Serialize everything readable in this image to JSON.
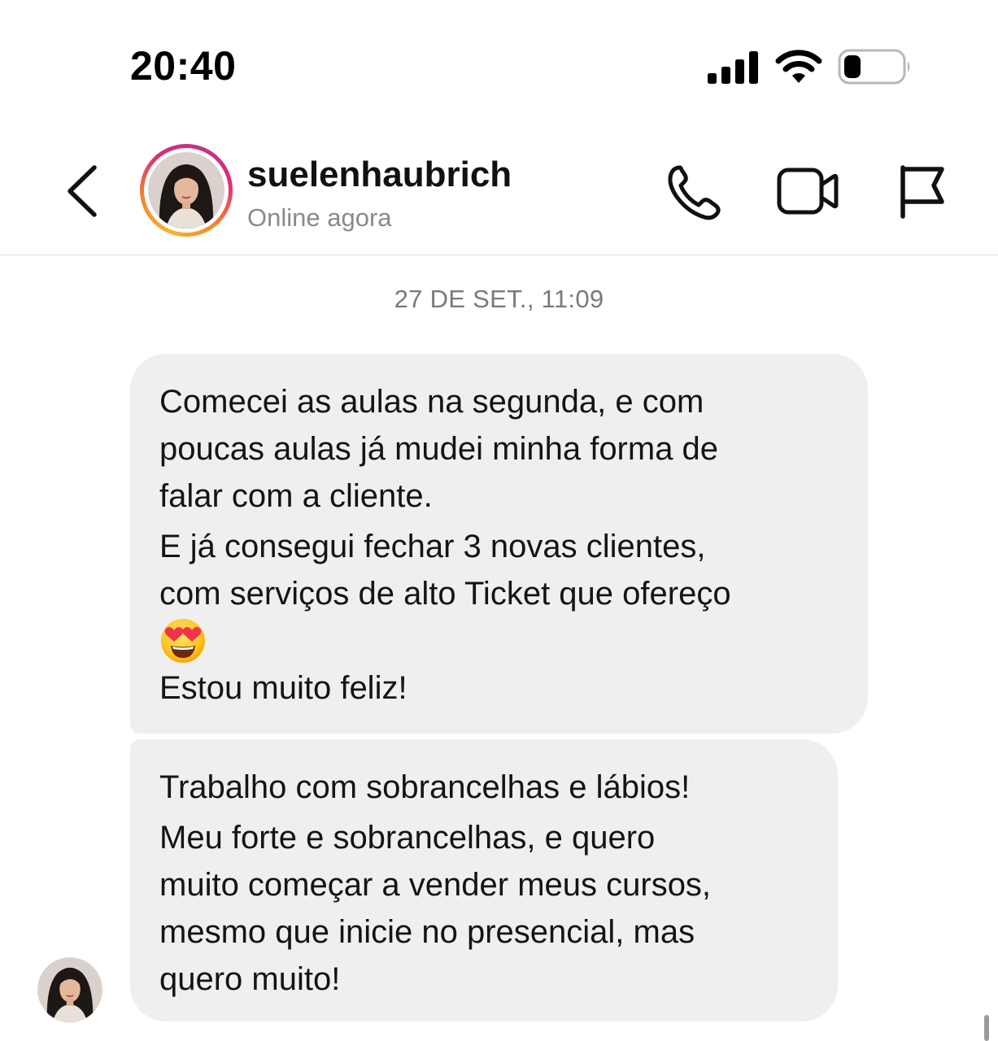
{
  "status_bar": {
    "time": "20:40",
    "signal_icon": "cellular-signal-icon",
    "wifi_icon": "wifi-icon",
    "battery_icon": "battery-icon",
    "battery_level": 0.3
  },
  "header": {
    "back_icon": "chevron-left-icon",
    "username": "suelenhaubrich",
    "presence": "Online agora",
    "actions": [
      "phone-icon",
      "video-camera-icon",
      "flag-icon"
    ]
  },
  "thread": {
    "timestamp": "27 DE SET., 11:09",
    "messages": [
      {
        "lines": [
          "Comecei as aulas na segunda, e com",
          "poucas aulas já mudei minha forma de",
          "falar com a cliente.",
          "E já consegui fechar 3 novas clientes,",
          "com serviços de alto Ticket que ofereço",
          "Estou muito feliz!"
        ],
        "emoji": "smiling-face-with-heart-eyes"
      },
      {
        "lines": [
          "Trabalho com sobrancelhas e lábios!",
          "Meu forte e sobrancelhas, e quero",
          "muito começar a vender meus cursos,",
          "mesmo que inicie no presencial, mas",
          "quero muito!"
        ]
      }
    ]
  },
  "colors": {
    "bubble": "#efefef",
    "secondary_text": "#8a8a8a",
    "story_ring": [
      "#f9b233",
      "#dd2a7b",
      "#c13584"
    ]
  }
}
